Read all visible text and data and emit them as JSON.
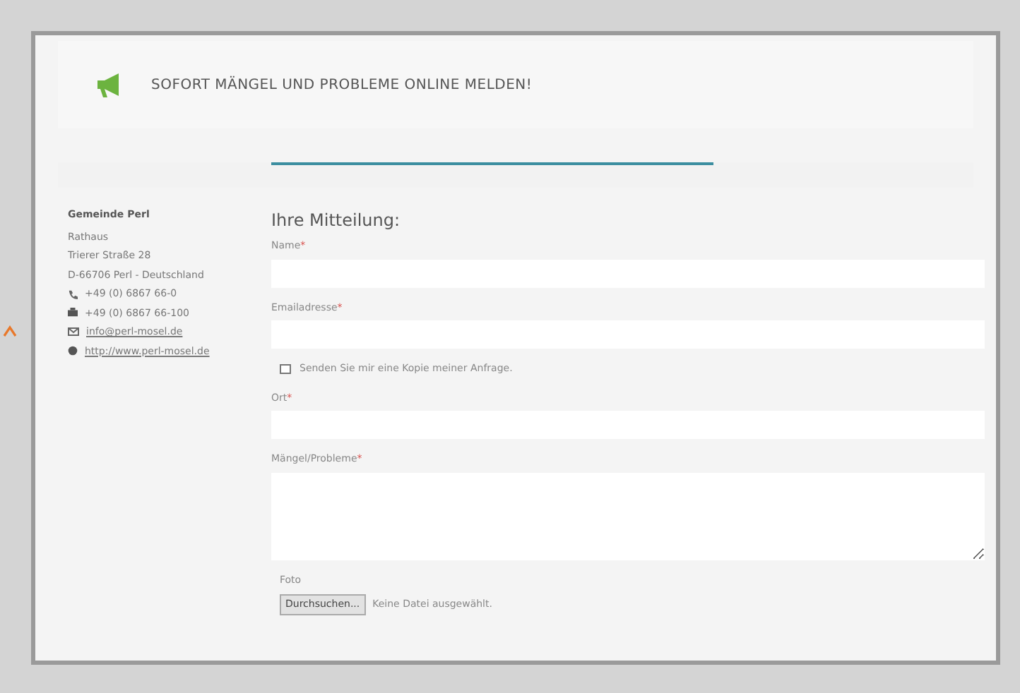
{
  "header": {
    "title": "SOFORT MÄNGEL UND PROBLEME ONLINE MELDEN!"
  },
  "contact": {
    "name": "Gemeinde Perl",
    "lines": [
      {
        "kind": "text",
        "text": "Rathaus"
      },
      {
        "kind": "text",
        "text": "Trierer Straße 28"
      },
      {
        "kind": "text",
        "text": "D-66706 Perl - Deutschland"
      },
      {
        "kind": "phone",
        "text": "+49 (0) 6867 66-0"
      },
      {
        "kind": "fax",
        "text": "+49 (0) 6867 66-100"
      },
      {
        "kind": "email",
        "text": "info@perl-mosel.de"
      },
      {
        "kind": "web",
        "text": "http://www.perl-mosel.de"
      }
    ]
  },
  "form": {
    "title": "Ihre Mitteilung:",
    "items": [
      {
        "kind": "input",
        "label": "Name",
        "mark": "*"
      },
      {
        "kind": "input",
        "label": "Emailadresse",
        "mark": "*"
      },
      {
        "kind": "checkbox",
        "label": "Senden Sie mir eine Kopie meiner Anfrage.",
        "checked": false
      },
      {
        "kind": "input",
        "label": "Ort",
        "mark": "*"
      },
      {
        "kind": "textarea",
        "label": "Mängel/Probleme",
        "mark": "*"
      },
      {
        "kind": "file",
        "label": "Foto",
        "button": "Durchsuchen...",
        "status": "Keine Datei ausgewählt."
      }
    ]
  }
}
